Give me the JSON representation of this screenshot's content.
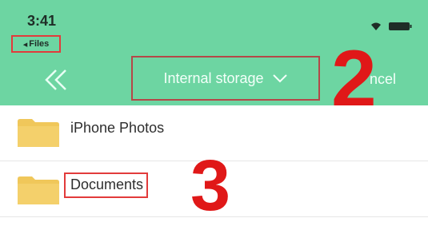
{
  "status_bar": {
    "time": "3:41",
    "back_app_label": "Files",
    "icons": [
      "wifi-icon",
      "battery-icon"
    ]
  },
  "nav": {
    "location": "Internal storage",
    "cancel_label": "ncel",
    "icons": [
      "double-chevron-left-icon",
      "chevron-down-icon"
    ]
  },
  "annotations": {
    "marker_2": "2",
    "marker_3": "3"
  },
  "files": [
    {
      "name": "iPhone Photos",
      "icon": "folder-icon"
    },
    {
      "name": "Documents",
      "icon": "folder-icon"
    }
  ],
  "colors": {
    "header": "#6dd5a2",
    "highlight_box": "#e23b3b",
    "annotation": "#e01818",
    "folder": "#f0c75a"
  }
}
